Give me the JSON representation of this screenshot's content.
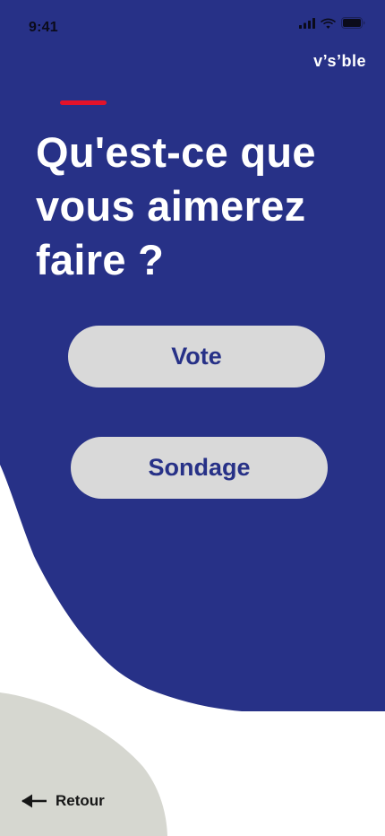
{
  "status_bar": {
    "time": "9:41",
    "icons": [
      "cellular-signal-icon",
      "wifi-icon",
      "battery-icon"
    ]
  },
  "brand": {
    "name": "v’s’ble"
  },
  "main": {
    "heading": "Qu'est-ce que vous aimerez faire ?"
  },
  "choices": {
    "vote_label": "Vote",
    "sondage_label": "Sondage"
  },
  "footer": {
    "back_label": "Retour",
    "back_icon": "arrow-left-icon"
  },
  "colors": {
    "primary_blue": "#273187",
    "accent_red": "#e3122a",
    "button_gray": "#d9d9d9",
    "corner_gray": "#d6d7d0",
    "text_dark": "#161616",
    "background": "#ffffff"
  }
}
